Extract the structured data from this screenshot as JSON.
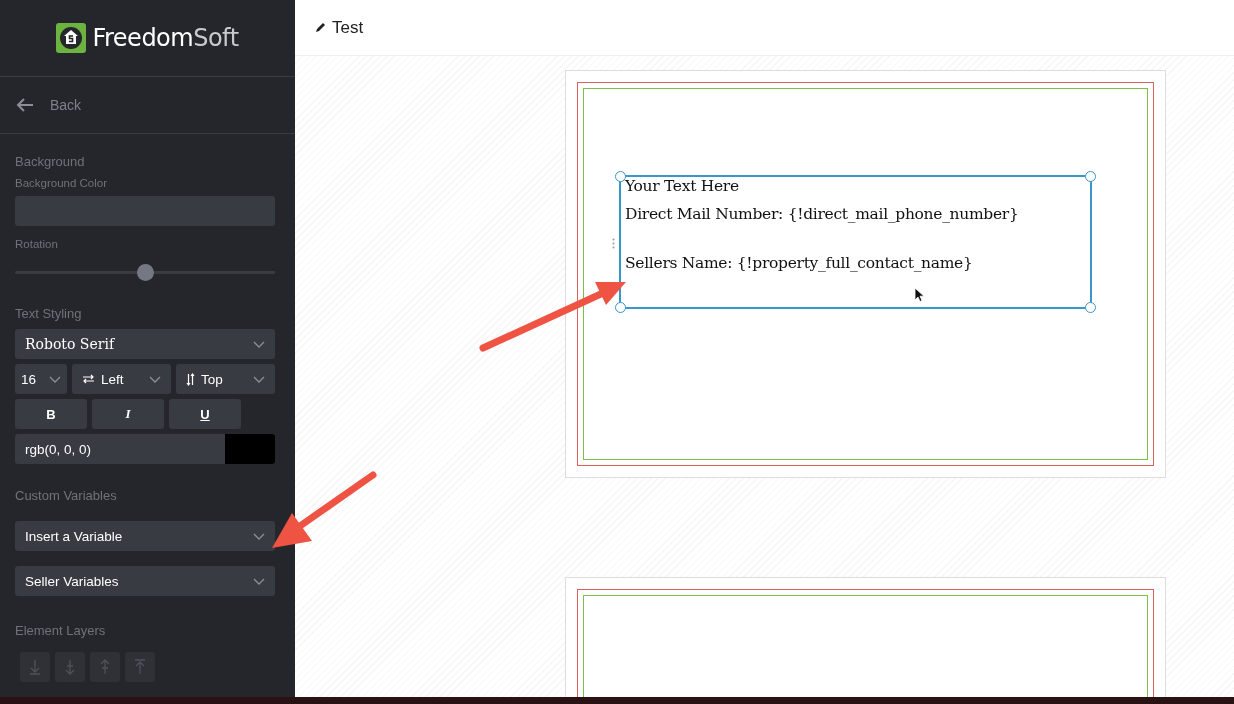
{
  "sidebar": {
    "logo": {
      "word_bold": "Freedom",
      "word_light": "Soft"
    },
    "back": "Back",
    "sections": [
      {
        "kind": "background",
        "title": "Background",
        "color_label": "Background Color",
        "rotation_label": "Rotation",
        "rotation": {
          "level": 0.5
        }
      },
      {
        "kind": "text",
        "title": "Text Styling",
        "font": "Roboto Serif",
        "size": "16",
        "align": "Left",
        "valign": "Top",
        "styles": [
          {
            "label": "B",
            "kind": "bold"
          },
          {
            "label": "I",
            "kind": "italic"
          },
          {
            "label": "U",
            "kind": "underline"
          }
        ],
        "color_value": "rgb(0, 0, 0)"
      },
      {
        "kind": "variables",
        "title": "Custom Variables",
        "dropdowns": [
          "Insert a Variable",
          "Seller Variables"
        ]
      },
      {
        "kind": "layers",
        "title": "Element Layers",
        "buttons": [
          {
            "kind": "bottom",
            "disabled": true
          },
          {
            "kind": "down",
            "disabled": true
          },
          {
            "kind": "up",
            "disabled": true
          },
          {
            "kind": "top",
            "disabled": true
          }
        ]
      }
    ]
  },
  "header": {
    "title": "Test"
  },
  "pages": [
    {
      "kind": "design",
      "text_box": {
        "selected": true,
        "lines": [
          "Your Text Here",
          "Direct Mail Number: {!direct_mail_phone_number}",
          "Sellers Name: {!property_full_contact_name}"
        ]
      }
    },
    {
      "kind": "design"
    }
  ]
}
